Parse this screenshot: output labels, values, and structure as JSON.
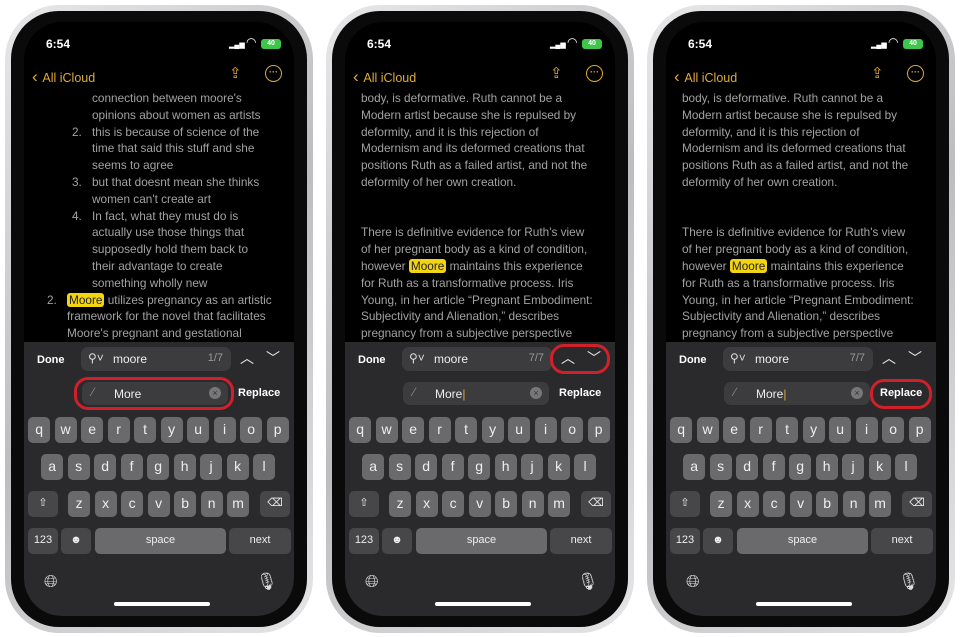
{
  "status": {
    "time": "6:54",
    "battery": "40"
  },
  "nav": {
    "back_label": "All iCloud",
    "share_icon": "share-icon",
    "more_icon": "ellipsis-circle-icon"
  },
  "colors": {
    "accent": "#e0a93a",
    "highlight": "#f3d412",
    "callout": "#d0202a"
  },
  "find": {
    "done_label": "Done",
    "query": "moore",
    "replace_label": "Replace",
    "replace_value": "More"
  },
  "keyboard": {
    "row1": [
      "q",
      "w",
      "e",
      "r",
      "t",
      "y",
      "u",
      "i",
      "o",
      "p"
    ],
    "row2": [
      "a",
      "s",
      "d",
      "f",
      "g",
      "h",
      "j",
      "k",
      "l"
    ],
    "row3": [
      "z",
      "x",
      "c",
      "v",
      "b",
      "n",
      "m"
    ],
    "numbers_label": "123",
    "space_label": "space",
    "next_label": "next"
  },
  "phones": [
    {
      "counter": "1/7",
      "callout": "replace-field",
      "cursor": false,
      "lines": [
        {
          "i": 2,
          "t": "connection between moore's"
        },
        {
          "i": 2,
          "t": "opinions about women as artists"
        },
        {
          "i": 2,
          "n": "2.",
          "t": "this is because of science of the"
        },
        {
          "i": 2,
          "t": "time that said this stuff and she"
        },
        {
          "i": 2,
          "t": "seems to agree"
        },
        {
          "i": 2,
          "n": "3.",
          "t": "but that doesnt mean she thinks"
        },
        {
          "i": 2,
          "t": "women can't create art"
        },
        {
          "i": 2,
          "n": "4.",
          "t": "In fact, what they must do is"
        },
        {
          "i": 2,
          "t": "actually use those things that"
        },
        {
          "i": 2,
          "t": "supposedly hold them back to"
        },
        {
          "i": 2,
          "t": "their advantage to create"
        },
        {
          "i": 2,
          "t": "something wholly new"
        },
        {
          "i": 1,
          "n": "2.",
          "pre": "",
          "hl": "Moore",
          "post": " utilizes pregnancy as an artistic"
        },
        {
          "i": 1,
          "t": "framework for the novel that facilitates"
        },
        {
          "i": 1,
          "t": "Moore's pregnant and gestational"
        }
      ]
    },
    {
      "counter": "7/7",
      "callout": "nav-arrows",
      "cursor": true,
      "lines": [
        {
          "i": 0,
          "t": "body, is deformative. Ruth cannot be a"
        },
        {
          "i": 0,
          "t": "Modern artist because she is repulsed by"
        },
        {
          "i": 0,
          "t": "deformity, and it is this rejection of"
        },
        {
          "i": 0,
          "t": "Modernism and its deformed creations that"
        },
        {
          "i": 0,
          "t": "positions Ruth as a failed artist, and not the"
        },
        {
          "i": 0,
          "t": "deformity of her own creation."
        },
        {
          "i": 0,
          "t": ""
        },
        {
          "i": 0,
          "t": ""
        },
        {
          "i": 0,
          "t": "There is definitive evidence for Ruth's view"
        },
        {
          "i": 0,
          "t": "of her pregnant body as a kind of condition,"
        },
        {
          "i": 0,
          "pre": "however ",
          "hl": "Moore",
          "post": " maintains this experience"
        },
        {
          "i": 0,
          "t": "for Ruth as a transformative process. Iris"
        },
        {
          "i": 0,
          "t": "Young, in her article “Pregnant Embodiment:"
        },
        {
          "i": 0,
          "t": "Subjectivity and Alienation,” describes"
        },
        {
          "i": 0,
          "t": "pregnancy from a subjective perspective"
        }
      ]
    },
    {
      "counter": "7/7",
      "callout": "replace-button",
      "cursor": true,
      "lines": [
        {
          "i": 0,
          "t": "body, is deformative. Ruth cannot be a"
        },
        {
          "i": 0,
          "t": "Modern artist because she is repulsed by"
        },
        {
          "i": 0,
          "t": "deformity, and it is this rejection of"
        },
        {
          "i": 0,
          "t": "Modernism and its deformed creations that"
        },
        {
          "i": 0,
          "t": "positions Ruth as a failed artist, and not the"
        },
        {
          "i": 0,
          "t": "deformity of her own creation."
        },
        {
          "i": 0,
          "t": ""
        },
        {
          "i": 0,
          "t": ""
        },
        {
          "i": 0,
          "t": "There is definitive evidence for Ruth's view"
        },
        {
          "i": 0,
          "t": "of her pregnant body as a kind of condition,"
        },
        {
          "i": 0,
          "pre": "however ",
          "hl": "Moore",
          "post": " maintains this experience"
        },
        {
          "i": 0,
          "t": "for Ruth as a transformative process. Iris"
        },
        {
          "i": 0,
          "t": "Young, in her article “Pregnant Embodiment:"
        },
        {
          "i": 0,
          "t": "Subjectivity and Alienation,” describes"
        },
        {
          "i": 0,
          "t": "pregnancy from a subjective perspective"
        }
      ]
    }
  ]
}
